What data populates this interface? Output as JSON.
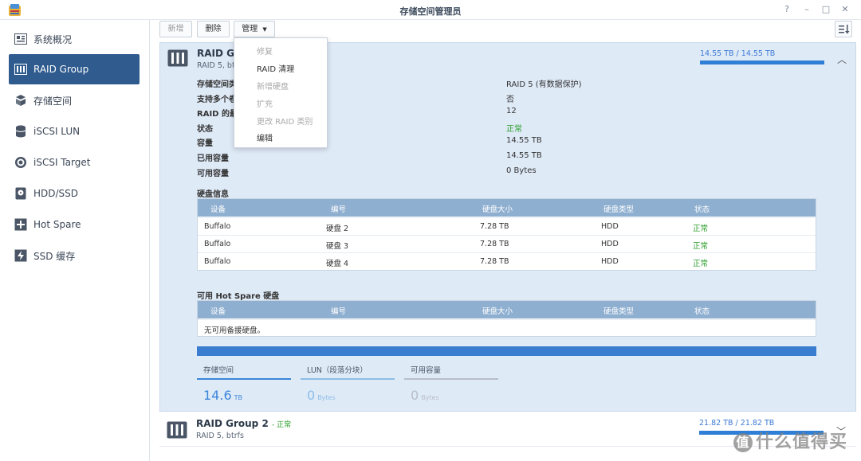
{
  "window": {
    "title": "存储空间管理员"
  },
  "sidebar": {
    "items": [
      {
        "label": "系统概况",
        "icon": "overview-icon"
      },
      {
        "label": "RAID Group",
        "icon": "raid-icon"
      },
      {
        "label": "存储空间",
        "icon": "storage-icon"
      },
      {
        "label": "iSCSI LUN",
        "icon": "lun-icon"
      },
      {
        "label": "iSCSI Target",
        "icon": "target-icon"
      },
      {
        "label": "HDD/SSD",
        "icon": "disk-icon"
      },
      {
        "label": "Hot Spare",
        "icon": "hotspare-icon"
      },
      {
        "label": "SSD 缓存",
        "icon": "ssd-cache-icon"
      }
    ]
  },
  "toolbar": {
    "create": "新增",
    "delete": "删除",
    "manage": "管理"
  },
  "manage_menu": [
    {
      "label": "修复",
      "enabled": false
    },
    {
      "label": "RAID 清理",
      "enabled": true
    },
    {
      "label": "新增硬盘",
      "enabled": false
    },
    {
      "label": "扩充",
      "enabled": false
    },
    {
      "label": "更改 RAID 类别",
      "enabled": false
    },
    {
      "label": "编辑",
      "enabled": true
    }
  ],
  "raid1": {
    "title": "RAID Gr",
    "subtitle": "RAID 5, btr",
    "capacity": "14.55 TB / 14.55 TB",
    "info": [
      {
        "label": "存储空间类",
        "value": "RAID 5 (有数据保护)"
      },
      {
        "label": "支持多个卷",
        "value": "否"
      },
      {
        "label": "RAID 的最",
        "value": "12"
      },
      {
        "label": "状态",
        "value": "正常"
      },
      {
        "label": "容量",
        "value": "14.55 TB"
      },
      {
        "label": "已用容量",
        "value": "14.55 TB"
      },
      {
        "label": "可用容量",
        "value": "0 Bytes"
      }
    ],
    "disk_section_title": "硬盘信息",
    "columns": [
      "设备",
      "编号",
      "硬盘大小",
      "硬盘类型",
      "状态"
    ],
    "disks": [
      {
        "device": "Buffalo",
        "id": "硬盘 2",
        "size": "7.28 TB",
        "type": "HDD",
        "status": "正常"
      },
      {
        "device": "Buffalo",
        "id": "硬盘 3",
        "size": "7.28 TB",
        "type": "HDD",
        "status": "正常"
      },
      {
        "device": "Buffalo",
        "id": "硬盘 4",
        "size": "7.28 TB",
        "type": "HDD",
        "status": "正常"
      }
    ],
    "hotspare_section_title": "可用 Hot Spare 硬盘",
    "hotspare_empty": "无可用备援硬盘。",
    "stats": [
      {
        "label": "存储空间",
        "value": "14.6",
        "unit": "TB",
        "color": "#3b86d9"
      },
      {
        "label": "LUN（段落分块）",
        "value": "0",
        "unit": "Bytes",
        "color": "#8cbde8"
      },
      {
        "label": "可用容量",
        "value": "0",
        "unit": "Bytes",
        "color": "#b8bec6"
      }
    ]
  },
  "raid2": {
    "title": "RAID Group 2",
    "status": "- 正常",
    "subtitle": "RAID 5, btrfs",
    "capacity": "21.82 TB / 21.82 TB"
  },
  "watermark": {
    "circle": "值",
    "text": "什么值得买"
  },
  "colors": {
    "accent": "#2f5b8e",
    "bar": "#2f7fd6",
    "ok": "#2a9d2a"
  }
}
